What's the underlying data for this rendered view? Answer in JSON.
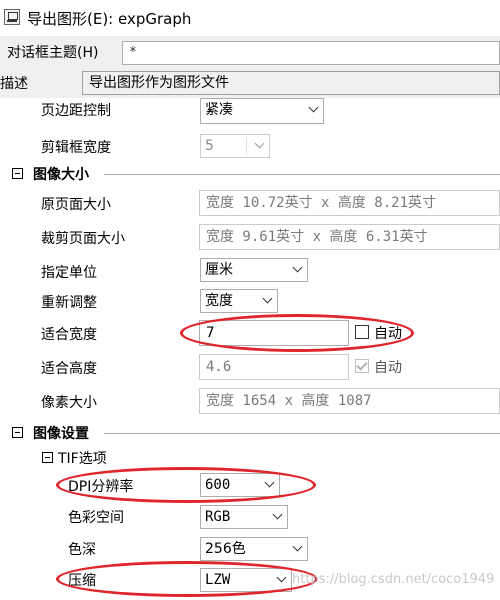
{
  "window": {
    "title": "导出图形(E): expGraph"
  },
  "header": {
    "theme_label": "对话框主题(H)",
    "theme_value": "*",
    "desc_label": "描述",
    "desc_value": "导出图形作为图形文件"
  },
  "margin_section": {
    "margin_label": "页边距控制",
    "margin_value": "紧凑",
    "clip_width_label": "剪辑框宽度",
    "clip_width_value": "5"
  },
  "image_size": {
    "group_label": "图像大小",
    "original_size_label": "原页面大小",
    "original_size_value": "宽度 10.72英寸 x 高度 8.21英寸",
    "crop_size_label": "裁剪页面大小",
    "crop_size_value": "宽度 9.61英寸 x 高度 6.31英寸",
    "unit_label": "指定单位",
    "unit_value": "厘米",
    "rescale_label": "重新调整",
    "rescale_value": "宽度",
    "fit_width_label": "适合宽度",
    "fit_width_value": "7",
    "fit_width_auto": "自动",
    "fit_height_label": "适合高度",
    "fit_height_value": "4.6",
    "fit_height_auto": "自动",
    "pixel_size_label": "像素大小",
    "pixel_size_value": "宽度 1654 x 高度 1087"
  },
  "image_settings": {
    "group_label": "图像设置",
    "tif_label": "TIF选项",
    "dpi_label": "DPI分辨率",
    "dpi_value": "600",
    "color_space_label": "色彩空间",
    "color_space_value": "RGB",
    "color_depth_label": "色深",
    "color_depth_value": "256色",
    "compression_label": "压缩",
    "compression_value": "LZW"
  },
  "watermark": "https://blog.csdn.net/coco1949",
  "colors": {
    "annotation": "#e0262d"
  }
}
